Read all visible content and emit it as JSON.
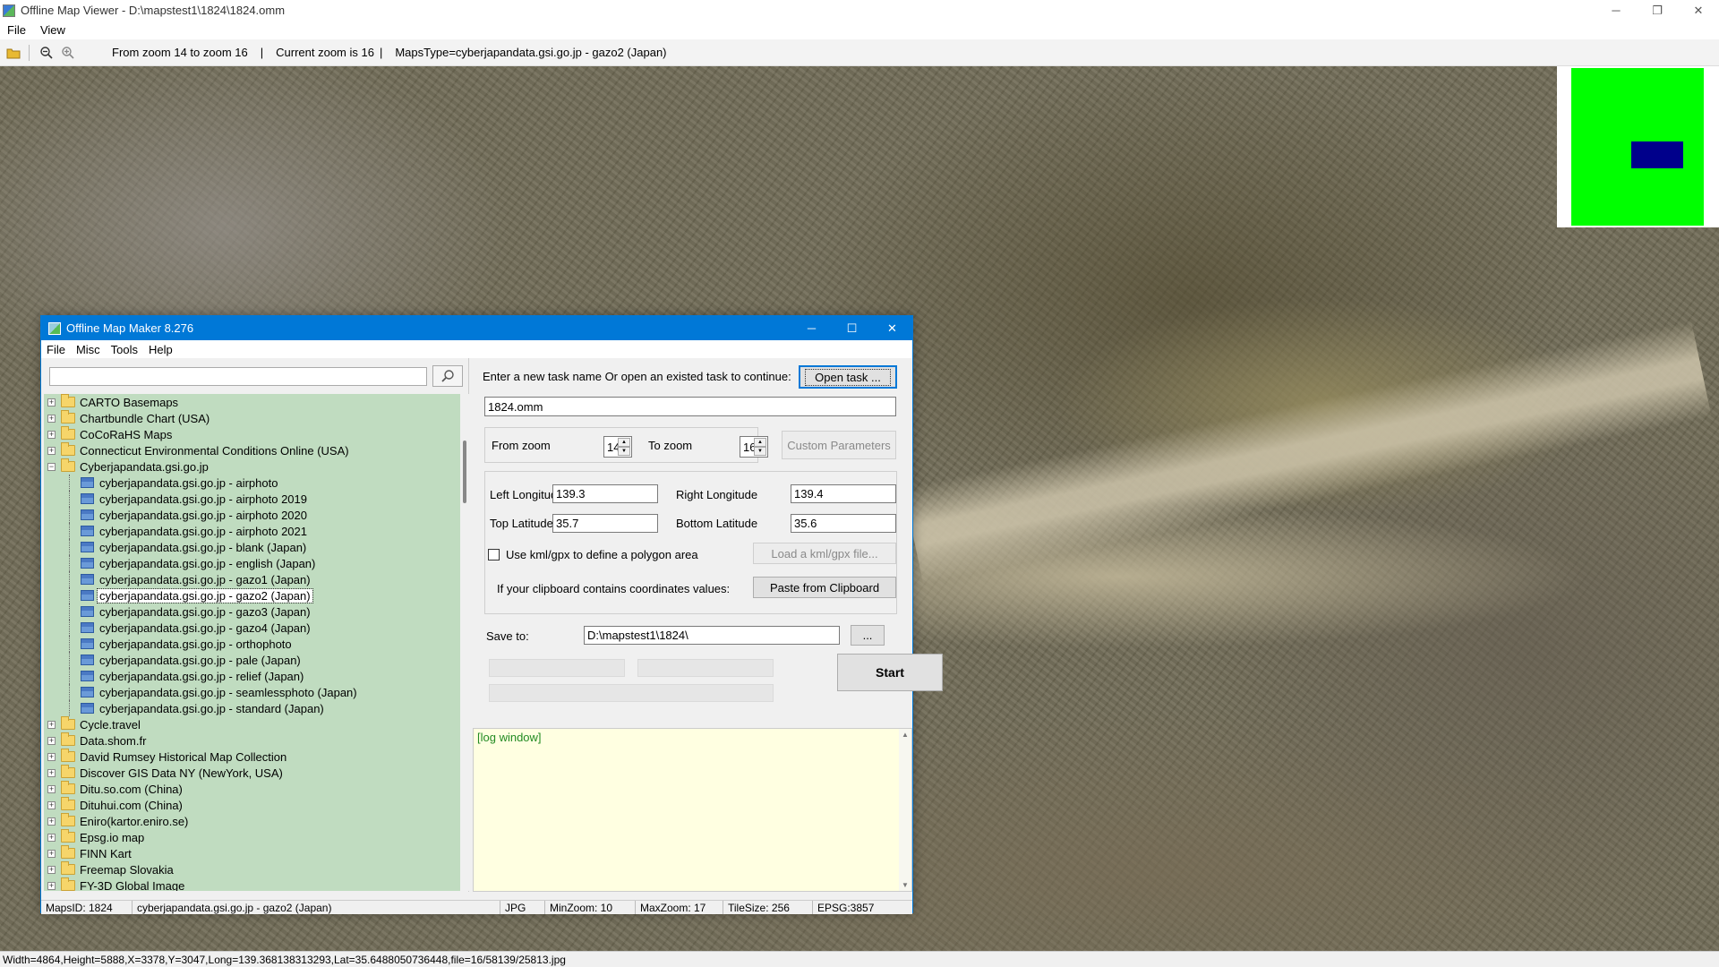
{
  "viewer": {
    "title": "Offline Map Viewer - D:\\mapstest1\\1824\\1824.omm",
    "menu": [
      "File",
      "View"
    ],
    "toolbar": {
      "zoom_range": "From zoom 14 to zoom 16",
      "current_zoom": "Current zoom is 16",
      "maps_type": "MapsType=cyberjapandata.gsi.go.jp - gazo2 (Japan)"
    },
    "status": "Width=4864,Height=5888,X=3378,Y=3047,Long=139.368138313293,Lat=35.6488050736448,file=16/58139/25813.jpg",
    "overview_colors": {
      "background": "#00ff00",
      "viewport": "#00008b"
    }
  },
  "dialog": {
    "title": "Offline Map Maker 8.276",
    "menu": [
      "File",
      "Misc",
      "Tools",
      "Help"
    ],
    "search": {
      "value": "",
      "placeholder": ""
    },
    "tree": {
      "before": [
        "CARTO Basemaps",
        "Chartbundle Chart (USA)",
        "CoCoRaHS Maps",
        "Connecticut Environmental Conditions Online (USA)"
      ],
      "expanded": {
        "label": "Cyberjapandata.gsi.go.jp",
        "children": [
          "cyberjapandata.gsi.go.jp - airphoto",
          "cyberjapandata.gsi.go.jp - airphoto 2019",
          "cyberjapandata.gsi.go.jp - airphoto 2020",
          "cyberjapandata.gsi.go.jp - airphoto 2021",
          "cyberjapandata.gsi.go.jp - blank (Japan)",
          "cyberjapandata.gsi.go.jp - english (Japan)",
          "cyberjapandata.gsi.go.jp - gazo1 (Japan)",
          "cyberjapandata.gsi.go.jp - gazo2 (Japan)",
          "cyberjapandata.gsi.go.jp - gazo3 (Japan)",
          "cyberjapandata.gsi.go.jp - gazo4 (Japan)",
          "cyberjapandata.gsi.go.jp - orthophoto",
          "cyberjapandata.gsi.go.jp - pale (Japan)",
          "cyberjapandata.gsi.go.jp - relief (Japan)",
          "cyberjapandata.gsi.go.jp - seamlessphoto (Japan)",
          "cyberjapandata.gsi.go.jp - standard (Japan)"
        ],
        "selected_index": 7
      },
      "after": [
        "Cycle.travel",
        "Data.shom.fr",
        "David Rumsey Historical Map Collection",
        "Discover GIS Data NY (NewYork, USA)",
        "Ditu.so.com (China)",
        "Dituhui.com (China)",
        "Eniro(kartor.eniro.se)",
        "Epsg.io map",
        "FINN Kart",
        "Freemap Slovakia",
        "FY-3D Global Image"
      ]
    },
    "task_prompt": "Enter a new task name Or open an existed task to continue:",
    "open_task_label": "Open task ...",
    "task_name": "1824.omm",
    "from_zoom_label": "From zoom",
    "from_zoom": "14",
    "to_zoom_label": "To zoom",
    "to_zoom": "16",
    "custom_params_label": "Custom Parameters",
    "left_lon_label": "Left Longitude",
    "left_lon": "139.3",
    "right_lon_label": "Right Longitude",
    "right_lon": "139.4",
    "top_lat_label": "Top Latitude",
    "top_lat": "35.7",
    "bottom_lat_label": "Bottom Latitude",
    "bottom_lat": "35.6",
    "kml_label": "Use kml/gpx to define a polygon area",
    "load_kml_label": "Load a kml/gpx file...",
    "clipboard_label": "If your clipboard contains coordinates values:",
    "paste_label": "Paste from Clipboard",
    "save_to_label": "Save to:",
    "save_to": "D:\\mapstest1\\1824\\",
    "browse_label": "...",
    "start_label": "Start",
    "log_text": "[log window]",
    "status": {
      "maps_id": "MapsID: 1824",
      "name": "cyberjapandata.gsi.go.jp - gazo2 (Japan)",
      "format": "JPG",
      "min_zoom": "MinZoom: 10",
      "max_zoom": "MaxZoom: 17",
      "tile_size": "TileSize: 256",
      "epsg": "EPSG:3857"
    }
  }
}
